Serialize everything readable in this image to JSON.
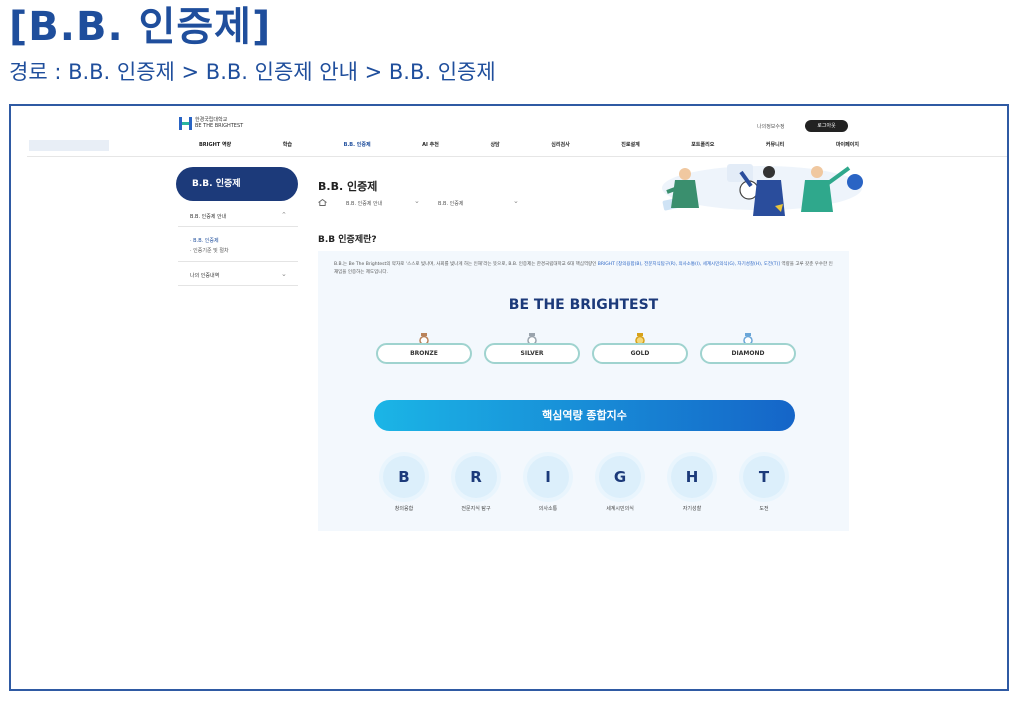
{
  "slide": {
    "title": "[B.B. 인증제]",
    "path": "경로 : B.B. 인증제 > B.B. 인증제 안내 > B.B. 인증제"
  },
  "header": {
    "logo_name": "한경국립대학교",
    "logo_tagline": "BE THE BRIGHTEST",
    "top_link": "나의정보수정",
    "login_label": "로그아웃",
    "nav": [
      "BRIGHT 역량",
      "학습",
      "B.B. 인증제",
      "AI 추천",
      "상담",
      "심리검사",
      "진로설계",
      "포트폴리오",
      "커뮤니티",
      "마이페이지"
    ],
    "active_nav_index": 2
  },
  "sidebar": {
    "title": "B.B. 인증제",
    "items": [
      {
        "label": "B.B. 인증제 안내"
      },
      {
        "label": "나의 인증내역"
      }
    ],
    "subitems": [
      "· B.B. 인증제",
      "· 인증기준 및 절차"
    ]
  },
  "content": {
    "page_title": "B.B. 인증제",
    "breadcrumb": [
      "B.B. 인증제 안내",
      "B.B. 인증제"
    ],
    "section_title": "B.B 인증제란?",
    "intro_parts": [
      "B.B.는 Be The Brightest의 약자로 ‘스스로 빛나며, 사회를 빛나게 하는 인재’라는 뜻으로, B.B. 인증제는 한경국립대학교 6대 핵심역량인 ",
      "BRIGHT [창의융합(B),",
      " ",
      "전문지식탐구(R), 의사소통(I), 세계시민의식(G), 자기성찰(H), 도전(T)]",
      " 역량을 고루 갖춘 우수한 인재임을 인증하는 제도입니다."
    ],
    "brightest": "BE THE BRIGHTEST",
    "medals": [
      {
        "label": "BRONZE",
        "color": "#b9835a"
      },
      {
        "label": "SILVER",
        "color": "#9aa4ad"
      },
      {
        "label": "GOLD",
        "color": "#d7a21a"
      },
      {
        "label": "DIAMOND",
        "color": "#6aa6d8"
      }
    ],
    "core_bar": "핵심역량 종합지수",
    "letters": [
      {
        "letter": "B",
        "caption": "창의융합"
      },
      {
        "letter": "R",
        "caption": "전문지식 탐구"
      },
      {
        "letter": "I",
        "caption": "의사소통"
      },
      {
        "letter": "G",
        "caption": "세계시민의식"
      },
      {
        "letter": "H",
        "caption": "자기성찰"
      },
      {
        "letter": "T",
        "caption": "도전"
      }
    ]
  },
  "colors": {
    "slide_text": "#1f4e9c",
    "frame_border": "#2f5aa3",
    "sidebar_title_bg": "#1c3a7a",
    "accent_blue": "#2a64c4",
    "panel_bg": "#f3f8fd"
  },
  "icons": [
    "logo-mark-icon",
    "home-icon",
    "chevron-down-icon",
    "chevron-up-icon",
    "medal-icon"
  ]
}
